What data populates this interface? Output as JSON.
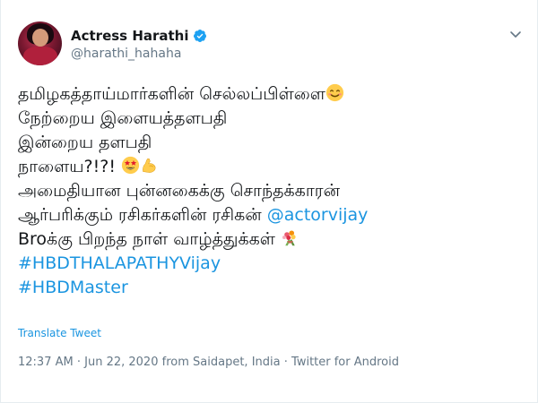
{
  "tweet": {
    "display_name": "Actress Harathi",
    "handle": "@harathi_hahaha",
    "verified": true,
    "lines": {
      "l1": "தமிழகத்தாய்மார்களின் செல்லப்பிள்ளை",
      "l2": "நேற்றைய இளையத்தளபதி",
      "l3": "இன்றைய தளபதி",
      "l4": "நாளைய?!?! ",
      "l5": "அமைதியான புன்னகைக்கு சொந்தக்காரன்",
      "l6_text": "ஆர்பரிக்கும் ரசிகர்களின் ரசிகன் ",
      "l6_mention": "@actorvijay",
      "l7": "Broக்கு பிறந்த நாள் வாழ்த்துக்கள் ",
      "l8": "#HBDTHALAPATHYVijay",
      "l9": "#HBDMaster"
    },
    "emojis": {
      "l1": "smiling-face-icon",
      "l4_a": "star-struck-icon",
      "l4_b": "flexed-biceps-icon",
      "l7": "bouquet-icon"
    },
    "translate_label": "Translate Tweet",
    "time": "12:37 AM",
    "date": "Jun 22, 2020",
    "from_label": "from",
    "location": "Saidapet, India",
    "separator": "·",
    "source": "Twitter for Android"
  },
  "colors": {
    "link": "#1b95e0",
    "verified": "#1da1f2",
    "secondary": "#657786",
    "text": "#14171a"
  }
}
